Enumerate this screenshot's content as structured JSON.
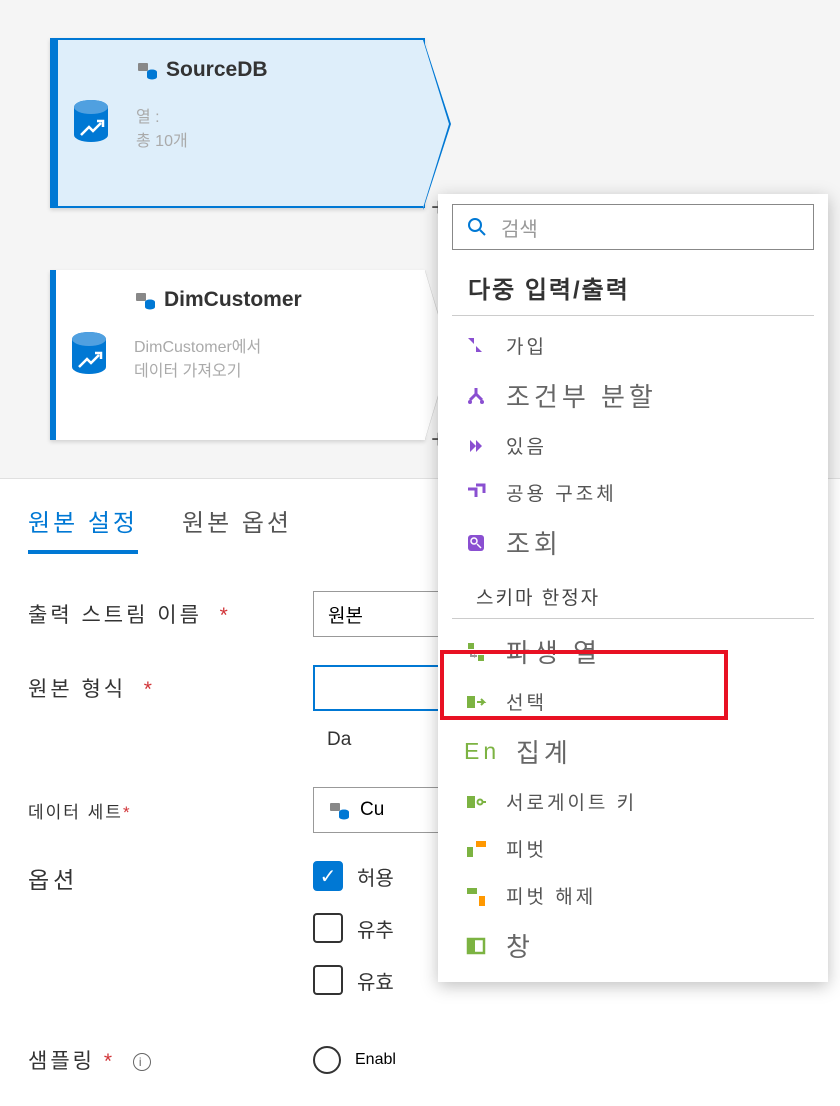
{
  "nodes": {
    "source": {
      "title": "SourceDB",
      "sub_line1": "열 :",
      "sub_line2": "총 10개"
    },
    "dim": {
      "title": "DimCustomer",
      "sub_line1": "DimCustomer에서",
      "sub_line2": "데이터 가져오기"
    }
  },
  "plus": "+",
  "tabs": {
    "t1": "원본 설정",
    "t2": "원본 옵션"
  },
  "form": {
    "stream_label": "출력 스트림 이름",
    "stream_value": "원본",
    "type_label": "원본 형식",
    "da_prefix": "Da",
    "dataset_label": "데이터 세트",
    "dataset_badge": "*",
    "dataset_value": "Cu",
    "options_label": "옵션",
    "chk_allow": "허용",
    "chk_infer": "유추",
    "chk_valid": "유효",
    "sampling_label": "샘플링",
    "sampling_radio": "Enabl",
    "required": "*"
  },
  "popup": {
    "search_placeholder": "검색",
    "header1": "다중 입력/출력",
    "header2": "스키마 한정자",
    "items": {
      "join": "가입",
      "split": "조건부 분할",
      "exists": "있음",
      "union": "공용 구조체",
      "lookup": "조회",
      "derived": "파생 열",
      "select": "선택",
      "aggregate": "집계",
      "aggregate_prefix": "En",
      "surrogate": "서로게이트 키",
      "pivot": "피벗",
      "unpivot": "피벗 해제",
      "window": "창"
    }
  }
}
